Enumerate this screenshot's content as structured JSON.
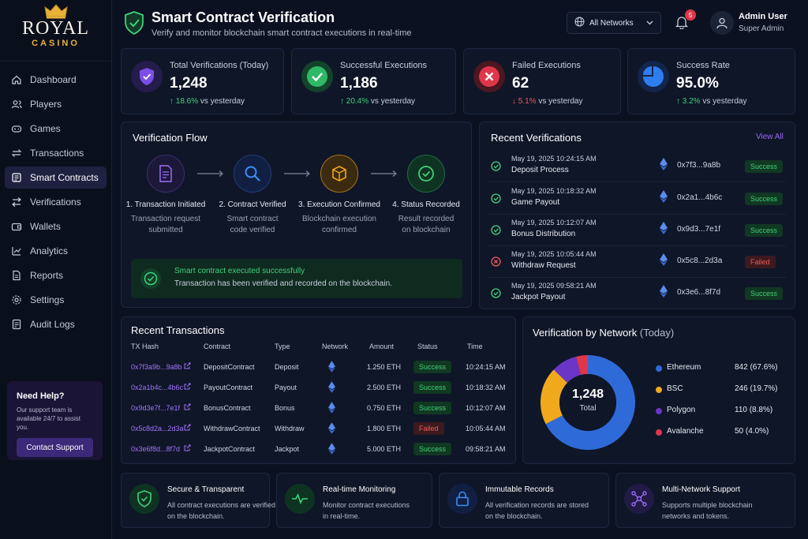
{
  "brand": {
    "name": "ROYAL",
    "sub": "CASINO"
  },
  "nav": [
    {
      "label": "Dashboard",
      "icon": "home-icon"
    },
    {
      "label": "Players",
      "icon": "users-icon"
    },
    {
      "label": "Games",
      "icon": "gamepad-icon"
    },
    {
      "label": "Transactions",
      "icon": "transfer-icon"
    },
    {
      "label": "Smart Contracts",
      "icon": "contract-icon",
      "active": true
    },
    {
      "label": "Verifications",
      "icon": "verify-icon"
    },
    {
      "label": "Wallets",
      "icon": "wallet-icon"
    },
    {
      "label": "Analytics",
      "icon": "analytics-icon"
    },
    {
      "label": "Reports",
      "icon": "report-icon"
    },
    {
      "label": "Settings",
      "icon": "gear-icon"
    },
    {
      "label": "Audit Logs",
      "icon": "audit-icon"
    }
  ],
  "help": {
    "title": "Need Help?",
    "desc": "Our support team is available 24/7 to assist you.",
    "button": "Contact Support"
  },
  "header": {
    "title": "Smart Contract Verification",
    "subtitle": "Verify and monitor blockchain smart contract executions in real-time",
    "network": "All Networks",
    "notifications": "5",
    "user_name": "Admin User",
    "user_role": "Super Admin"
  },
  "stats": [
    {
      "label": "Total Verifications (Today)",
      "value": "1,248",
      "change": "18.6%",
      "dir": "up",
      "suffix": "vs yesterday"
    },
    {
      "label": "Successful Executions",
      "value": "1,186",
      "change": "20.4%",
      "dir": "up",
      "suffix": "vs yesterday"
    },
    {
      "label": "Failed Executions",
      "value": "62",
      "change": "5.1%",
      "dir": "down",
      "suffix": "vs yesterday"
    },
    {
      "label": "Success Rate",
      "value": "95.0%",
      "change": "3.2%",
      "dir": "up",
      "suffix": "vs yesterday"
    }
  ],
  "flow": {
    "title": "Verification Flow",
    "steps": [
      {
        "name": "1. Transaction Initiated",
        "desc1": "Transaction request",
        "desc2": "submitted"
      },
      {
        "name": "2. Contract Verified",
        "desc1": "Smart contract",
        "desc2": "code verified"
      },
      {
        "name": "3. Execution Confirmed",
        "desc1": "Blockchain execution",
        "desc2": "confirmed"
      },
      {
        "name": "4. Status Recorded",
        "desc1": "Result recorded",
        "desc2": "on blockchain"
      }
    ],
    "success_title": "Smart contract executed successfully",
    "success_desc": "Transaction has been verified and recorded on the blockchain."
  },
  "recent_verifications": {
    "title": "Recent Verifications",
    "view_all": "View All",
    "rows": [
      {
        "date": "May 19, 2025 10:24:15 AM",
        "type": "Deposit Process",
        "hash": "0x7f3...9a8b",
        "status": "Success"
      },
      {
        "date": "May 19, 2025 10:18:32 AM",
        "type": "Game Payout",
        "hash": "0x2a1...4b6c",
        "status": "Success"
      },
      {
        "date": "May 19, 2025 10:12:07 AM",
        "type": "Bonus Distribution",
        "hash": "0x9d3...7e1f",
        "status": "Success"
      },
      {
        "date": "May 19, 2025 10:05:44 AM",
        "type": "Withdraw Request",
        "hash": "0x5c8...2d3a",
        "status": "Failed"
      },
      {
        "date": "May 19, 2025 09:58:21 AM",
        "type": "Jackpot Payout",
        "hash": "0x3e6...8f7d",
        "status": "Success"
      }
    ]
  },
  "transactions": {
    "title": "Recent Transactions",
    "headers": {
      "hash": "TX Hash",
      "contract": "Contract",
      "type": "Type",
      "network": "Network",
      "amount": "Amount",
      "status": "Status",
      "time": "Time"
    },
    "rows": [
      {
        "hash": "0x7f3a9b...9a8b",
        "contract": "DepositContract",
        "type": "Deposit",
        "amount": "1.250 ETH",
        "status": "Success",
        "time": "10:24:15 AM"
      },
      {
        "hash": "0x2a1b4c...4b6c",
        "contract": "PayoutContract",
        "type": "Payout",
        "amount": "2.500 ETH",
        "status": "Success",
        "time": "10:18:32 AM"
      },
      {
        "hash": "0x9d3e7f...7e1f",
        "contract": "BonusContract",
        "type": "Bonus",
        "amount": "0.750 ETH",
        "status": "Success",
        "time": "10:12:07 AM"
      },
      {
        "hash": "0x5c8d2a...2d3a",
        "contract": "WithdrawContract",
        "type": "Withdraw",
        "amount": "1.800 ETH",
        "status": "Failed",
        "time": "10:05:44 AM"
      },
      {
        "hash": "0x3e6f8d...8f7d",
        "contract": "JackpotContract",
        "type": "Jackpot",
        "amount": "5.000 ETH",
        "status": "Success",
        "time": "09:58:21 AM"
      }
    ]
  },
  "network_chart": {
    "title": "Verification by Network",
    "title_suffix": "(Today)",
    "center_value": "1,248",
    "center_label": "Total"
  },
  "chart_data": {
    "type": "pie",
    "donut": true,
    "categories": [
      "Ethereum",
      "BSC",
      "Polygon",
      "Avalanche"
    ],
    "values": [
      842,
      246,
      110,
      50
    ],
    "labels": [
      "842 (67.6%)",
      "246 (19.7%)",
      "110 (8.8%)",
      "50 (4.0%)"
    ],
    "colors": [
      "#2f6bd8",
      "#f0a81c",
      "#6b36c7",
      "#e0364a"
    ],
    "legend": "right"
  },
  "features": [
    {
      "title": "Secure & Transparent",
      "desc1": "All contract executions are verified",
      "desc2": "on the blockchain.",
      "icon": "shield-check-icon"
    },
    {
      "title": "Real-time Monitoring",
      "desc1": "Monitor contract executions",
      "desc2": "in real-time.",
      "icon": "pulse-icon"
    },
    {
      "title": "Immutable Records",
      "desc1": "All verification records are stored",
      "desc2": "on the blockchain.",
      "icon": "lock-icon"
    },
    {
      "title": "Multi-Network Support",
      "desc1": "Supports multiple blockchain",
      "desc2": "networks and tokens.",
      "icon": "network-icon"
    }
  ]
}
